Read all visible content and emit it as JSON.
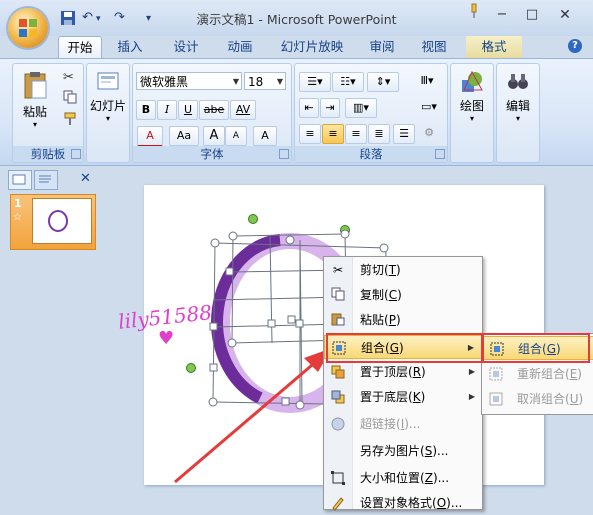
{
  "window": {
    "title": "演示文稿1 - Microsoft PowerPoint",
    "help": "?"
  },
  "tabs": [
    "开始",
    "插入",
    "设计",
    "动画",
    "幻灯片放映",
    "审阅",
    "视图",
    "格式"
  ],
  "ribbon": {
    "clipboard": {
      "label": "剪贴板",
      "paste": "粘贴"
    },
    "slides": {
      "label": "幻灯片"
    },
    "font": {
      "label": "字体",
      "name": "微软雅黑",
      "size": "18",
      "bold": "B",
      "italic": "I",
      "underline": "U",
      "strike": "abe",
      "spacing": "AV",
      "color": "A",
      "case": "Aa",
      "grow": "A",
      "shrink": "A",
      "clear": "A"
    },
    "paragraph": {
      "label": "段落"
    },
    "drawing": {
      "label": "绘图"
    },
    "editing": {
      "label": "编辑"
    }
  },
  "slide_panel": {
    "slide_number": "1",
    "close": "✕"
  },
  "watermark": "lily51588",
  "context_menu": [
    {
      "label": "剪切",
      "key": "T",
      "icon": "scissors-icon",
      "disabled": false
    },
    {
      "label": "复制",
      "key": "C",
      "icon": "copy-icon",
      "disabled": false
    },
    {
      "label": "粘贴",
      "key": "P",
      "icon": "paste-icon",
      "disabled": false
    },
    {
      "label": "组合",
      "key": "G",
      "icon": "group-icon",
      "disabled": false,
      "submenu": true,
      "highlighted": true
    },
    {
      "label": "置于顶层",
      "key": "R",
      "icon": "bring-front-icon",
      "disabled": false,
      "submenu": true
    },
    {
      "label": "置于底层",
      "key": "K",
      "icon": "send-back-icon",
      "disabled": false,
      "submenu": true
    },
    {
      "label": "超链接",
      "key": "I",
      "icon": "hyperlink-icon",
      "disabled": true
    },
    {
      "label": "另存为图片",
      "key": "S",
      "icon": "",
      "disabled": false
    },
    {
      "label": "大小和位置",
      "key": "Z",
      "icon": "size-position-icon",
      "disabled": false
    },
    {
      "label": "设置对象格式",
      "key": "O",
      "icon": "format-object-icon",
      "disabled": false
    }
  ],
  "submenu": [
    {
      "label": "组合",
      "key": "G",
      "disabled": false,
      "highlighted": true
    },
    {
      "label": "重新组合",
      "key": "E",
      "disabled": true
    },
    {
      "label": "取消组合",
      "key": "U",
      "disabled": true
    }
  ],
  "colors": {
    "highlight_border": "#e53b3b",
    "arrow": "#e53b3b",
    "shape_dark": "#6c2c9a",
    "shape_light": "#d8b4ec"
  }
}
